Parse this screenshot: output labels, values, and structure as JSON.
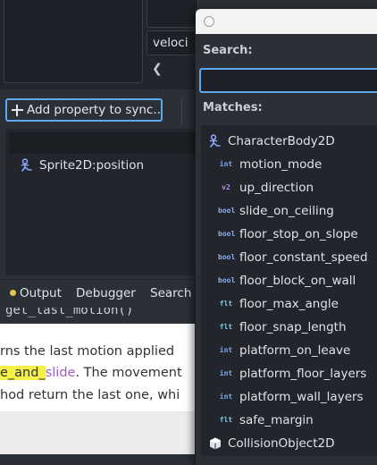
{
  "editor": {
    "field_value": "veloci",
    "chevron": "❮",
    "add_property_label": "Add property to sync...",
    "tree_item": "Sprite2D:position",
    "tabs": [
      "Output",
      "Debugger",
      "Search R"
    ],
    "doc": {
      "header": "get_last_motion() ",
      "line1": "rns the last motion applied",
      "line2_hl": "e_and_",
      "line2_purple": "slide",
      "line2_rest": ". The movement",
      "line3": "hod return the last one, whi"
    }
  },
  "popup": {
    "search_label": "Search:",
    "search_value": "",
    "matches_label": "Matches:",
    "root": "CharacterBody2D",
    "items": [
      {
        "type": "int",
        "name": "motion_mode",
        "color": "#7aa7e8"
      },
      {
        "type": "v2",
        "name": "up_direction",
        "color": "#b78cf2"
      },
      {
        "type": "bool",
        "name": "slide_on_ceiling",
        "color": "#8fb0ee"
      },
      {
        "type": "bool",
        "name": "floor_stop_on_slope",
        "color": "#8fb0ee"
      },
      {
        "type": "bool",
        "name": "floor_constant_speed",
        "color": "#8fb0ee"
      },
      {
        "type": "bool",
        "name": "floor_block_on_wall",
        "color": "#8fb0ee"
      },
      {
        "type": "flt",
        "name": "floor_max_angle",
        "color": "#7fc7e6"
      },
      {
        "type": "flt",
        "name": "floor_snap_length",
        "color": "#7fc7e6"
      },
      {
        "type": "int",
        "name": "platform_on_leave",
        "color": "#7aa7e8"
      },
      {
        "type": "int",
        "name": "platform_floor_layers",
        "color": "#7aa7e8"
      },
      {
        "type": "int",
        "name": "platform_wall_layers",
        "color": "#7aa7e8"
      },
      {
        "type": "flt",
        "name": "safe_margin",
        "color": "#7fc7e6"
      }
    ],
    "next_root": "CollisionObject2D"
  },
  "colors": {
    "accent": "#5fa9f0",
    "node_blue": "#8da5f3",
    "highlight": "#f6f04a"
  }
}
